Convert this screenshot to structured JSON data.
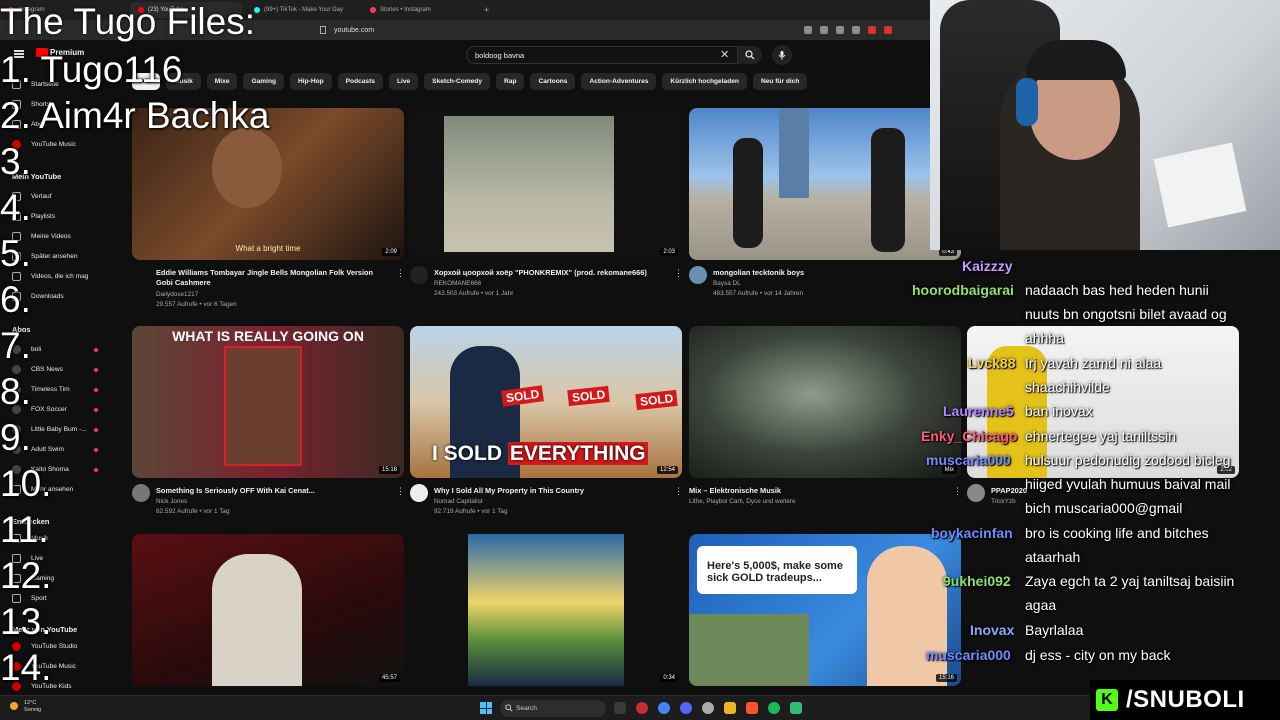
{
  "browser": {
    "tabs": [
      "Instagram",
      "(23) YouTube",
      "(99+) TikTok - Make Your Day",
      "Stories • Instagram"
    ],
    "url": "youtube.com"
  },
  "youtube": {
    "logo_text": "Premium",
    "search_value": "boldoog bavna",
    "chips": [
      "Alle",
      "Musik",
      "Mixe",
      "Gaming",
      "Hip-Hop",
      "Podcasts",
      "Live",
      "Sketch-Comedy",
      "Rap",
      "Cartoons",
      "Action-Adventures",
      "Kürzlich hochgeladen",
      "Neu für dich"
    ]
  },
  "sidebar": {
    "top_items": [
      "Startseite",
      "Shorts",
      "Abos",
      "YouTube Music"
    ],
    "mein_header": "Mein YouTube",
    "mein_items": [
      "Verlauf",
      "Playlists",
      "Meine Videos",
      "Später ansehen",
      "Videos, die ich mag",
      "Downloads"
    ],
    "abos_header": "Abos",
    "abos_items": [
      "boli",
      "CBS News",
      "Timeless Tim",
      "FOX Soccer",
      "Little Baby Bum -...",
      "Adult Swim",
      "Kaito Shoma",
      "Mehr ansehen"
    ],
    "entdecken_header": "Entdecken",
    "entdecken_items": [
      "Musik",
      "Live",
      "Gaming",
      "Sport"
    ],
    "mehr_header": "Mehr von YouTube",
    "mehr_items": [
      "YouTube Studio",
      "YouTube Music",
      "YouTube Kids"
    ]
  },
  "overlay": {
    "title": "The Tugo Files:",
    "items": [
      "1. Tugo116",
      "2.  Aim4r Bachka",
      "3.",
      "4.",
      "5.",
      "6.",
      "7.",
      "8.",
      "9.",
      "10.",
      "11.",
      "12.",
      "13.",
      "14."
    ]
  },
  "videos": [
    {
      "title": "Eddie Williams Tombayar Jingle Bells Mongolian Folk Version Gobi Cashmere",
      "channel": "Dailydose1217",
      "meta": "29.557 Aufrufe • vor 6 Tagen",
      "duration": "2:09",
      "caption": "What a bright time"
    },
    {
      "title": "Хорхой цоорхой хоёр \"PHONKREMIX\" (prod. rekomane666)",
      "channel": "REKOMANE666",
      "meta": "243.503 Aufrufe • vor 1 Jahr",
      "duration": "2:03",
      "caption": ""
    },
    {
      "title": "mongolian tecktonik boys",
      "channel": "Baysa DL",
      "meta": "483.557 Aufrufe • vor 14 Jahren",
      "duration": "0:43",
      "caption": ""
    },
    {
      "title": "Something Is Seriously OFF With Kai Cenat...",
      "channel": "Nick Jones",
      "meta": "82.592 Aufrufe • vor 1 Tag",
      "duration": "15:18",
      "caption": "WHAT IS REALLY GOING ON"
    },
    {
      "title": "Why I Sold All My Property in This Country",
      "channel": "Nomad Capitalist",
      "meta": "92.719 Aufrufe • vor 1 Tag",
      "duration": "12:54",
      "caption_a": "I SOLD",
      "caption_b": "EVERYTHING",
      "sold": "SOLD"
    },
    {
      "title": "Mix – Elektronische Musik",
      "channel": "Lithe, Playboi Carti, Dyce und weitere",
      "meta": "",
      "duration": "Mix",
      "caption": ""
    },
    {
      "title": "PPAP2020",
      "channel": "TrickYzb",
      "meta": "",
      "duration": "2:02",
      "caption": ""
    },
    {
      "title": "",
      "channel": "",
      "meta": "",
      "duration": "45:57",
      "caption": ""
    },
    {
      "title": "",
      "channel": "",
      "meta": "",
      "duration": "0:34",
      "caption": ""
    },
    {
      "title": "",
      "channel": "",
      "meta": "",
      "duration": "15:16",
      "caption": "Here's 5,000$, make some sick GOLD tradeups..."
    }
  ],
  "chat": [
    {
      "user": "Kaizzzy",
      "color": "#c99bff",
      "message": ""
    },
    {
      "user": "hoorodbaigarai",
      "color": "#8fe36a",
      "message": "nadaach bas hed heden hunii"
    },
    {
      "user": "",
      "color": "#ffffff",
      "message": "nuuts bn ongotsni bilet avaad og"
    },
    {
      "user": "",
      "color": "#ffffff",
      "message": "ahhha"
    },
    {
      "user": "Lvck88",
      "color": "#f5d547",
      "message": "Irj yavah zamd ni alaa"
    },
    {
      "user": "",
      "color": "#ffffff",
      "message": "shaachihvilde"
    },
    {
      "user": "Laurenne5",
      "color": "#b084ff",
      "message": "ban inovax"
    },
    {
      "user": "Enky_Chicago",
      "color": "#ff5a7a",
      "message": "ehnertegee yaj taniltssin"
    },
    {
      "user": "muscaria000",
      "color": "#6f8cff",
      "message": "hulsuur pedonudig zodood bicleg"
    },
    {
      "user": "",
      "color": "#ffffff",
      "message": "hiiged yvulah humuus baival mail"
    },
    {
      "user": "",
      "color": "#ffffff",
      "message": "bich muscaria000@gmail"
    },
    {
      "user": "boykacinfan",
      "color": "#6f8cff",
      "message": "bro is cooking life and bitches"
    },
    {
      "user": "",
      "color": "#ffffff",
      "message": "ataarhah"
    },
    {
      "user": "9ukhei092",
      "color": "#8fe36a",
      "message": "Zaya egch ta 2 yaj taniltsaj baisiin"
    },
    {
      "user": "",
      "color": "#ffffff",
      "message": "agaa"
    },
    {
      "user": "Inovax",
      "color": "#8fa6ff",
      "message": "Bayrlalaa"
    },
    {
      "user": "muscaria000",
      "color": "#6f8cff",
      "message": "dj ess - city on my back"
    }
  ],
  "taskbar": {
    "temp": "12°C",
    "weather": "Sonnig",
    "search_placeholder": "Search"
  },
  "streamer": {
    "handle": "/SNUBOLI",
    "kick_letter": "K"
  }
}
